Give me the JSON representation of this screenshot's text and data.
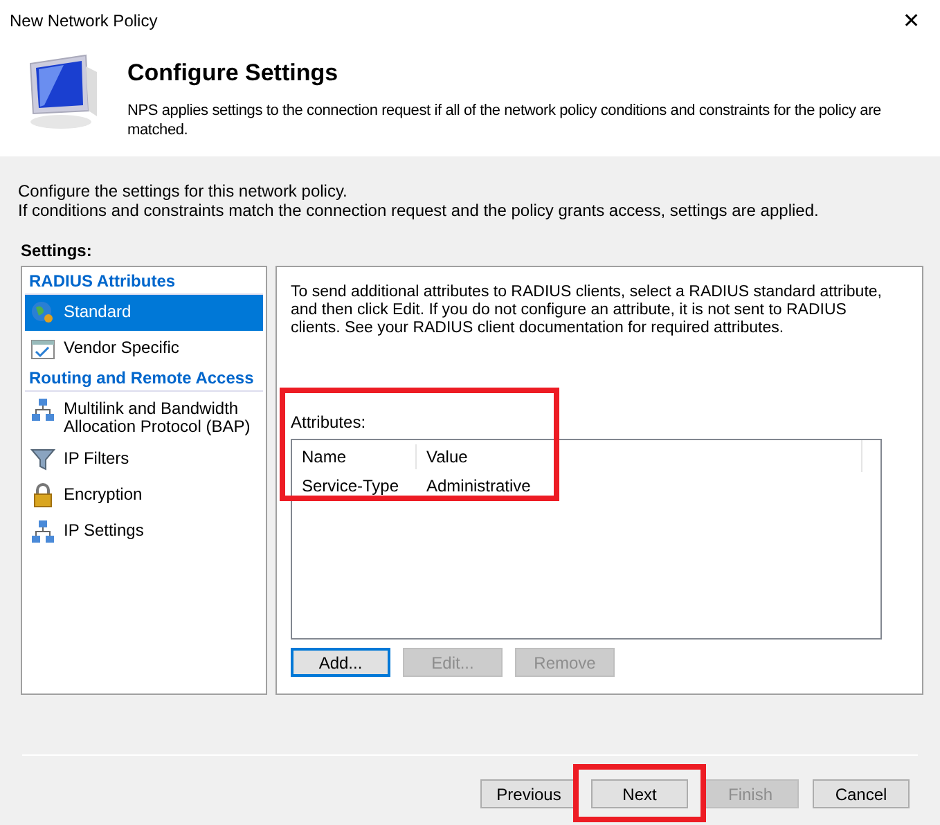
{
  "window": {
    "title": "New Network Policy",
    "close": "✕"
  },
  "header": {
    "title": "Configure Settings",
    "description": "NPS applies settings to the connection request if all of the network policy conditions and constraints for the policy are matched."
  },
  "intro": [
    "Configure the settings for this network policy.",
    "If conditions and constraints match the connection request and the policy grants access, settings are applied."
  ],
  "settings_label": "Settings:",
  "sidebar": {
    "items": [
      {
        "kind": "category",
        "label": "RADIUS Attributes"
      },
      {
        "kind": "item",
        "label": "Standard",
        "selected": true
      },
      {
        "kind": "item",
        "label": "Vendor Specific",
        "selected": false
      },
      {
        "kind": "category",
        "label": "Routing and Remote Access"
      },
      {
        "kind": "item",
        "label": "Multilink and Bandwidth Allocation Protocol (BAP)",
        "selected": false
      },
      {
        "kind": "item",
        "label": "IP Filters",
        "selected": false
      },
      {
        "kind": "item",
        "label": "Encryption",
        "selected": false
      },
      {
        "kind": "item",
        "label": "IP Settings",
        "selected": false
      }
    ]
  },
  "panel": {
    "description": "To send additional attributes to RADIUS clients, select a RADIUS standard attribute, and then click Edit. If you do not configure an attribute, it is not sent to RADIUS clients. See your RADIUS client documentation for required attributes.",
    "attributes_label": "Attributes:",
    "columns": [
      "Name",
      "Value"
    ],
    "rows": [
      [
        "Service-Type",
        "Administrative"
      ]
    ],
    "buttons": [
      {
        "label": "Add...",
        "disabled": false,
        "focused": true
      },
      {
        "label": "Edit...",
        "disabled": true,
        "focused": false
      },
      {
        "label": "Remove",
        "disabled": true,
        "focused": false
      }
    ]
  },
  "footer_buttons": [
    {
      "label": "Previous",
      "disabled": false
    },
    {
      "label": "Next",
      "disabled": false
    },
    {
      "label": "Finish",
      "disabled": true
    },
    {
      "label": "Cancel",
      "disabled": false
    }
  ]
}
